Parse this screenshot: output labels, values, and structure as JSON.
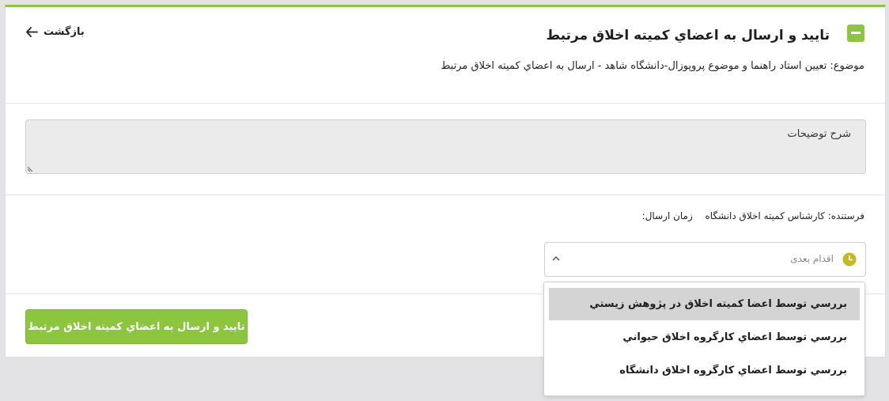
{
  "header": {
    "title": "تاييد و ارسال به اعضاي کميته اخلاق مرتبط",
    "back_label": "بازگشت",
    "subject": "موضوع: تعيين استاد راهنما و موضوع پروپوزال-دانشگاه شاهد - ارسال به اعضاي کميته اخلاق مرتبط"
  },
  "description": {
    "placeholder": "شرح توضيحات"
  },
  "meta": {
    "sender_label": "فرستنده:",
    "sender_value": "کارشناس کميته اخلاق دانشگاه",
    "time_label": "زمان ارسال:",
    "time_value": ""
  },
  "next_action": {
    "placeholder": "اقدام بعدی",
    "options": [
      "بررسي توسط اعضا كميته اخلاق در پژوهش زيستي",
      "بررسي توسط اعضاي کارگروه اخلاق حيواني",
      "بررسي توسط اعضاي کارگروه اخلاق دانشگاه"
    ],
    "highlighted_index": 0
  },
  "submit_label": "تاييد و ارسال به اعضاي کميته اخلاق مرتبط",
  "colors": {
    "accent": "#8cc63f",
    "clock": "#c8b820",
    "highlight": "#d4d4d4"
  },
  "icons": [
    "collapse-icon",
    "arrow-left-icon",
    "clock-icon",
    "chevron-up-icon",
    "resize-grip-icon"
  ]
}
